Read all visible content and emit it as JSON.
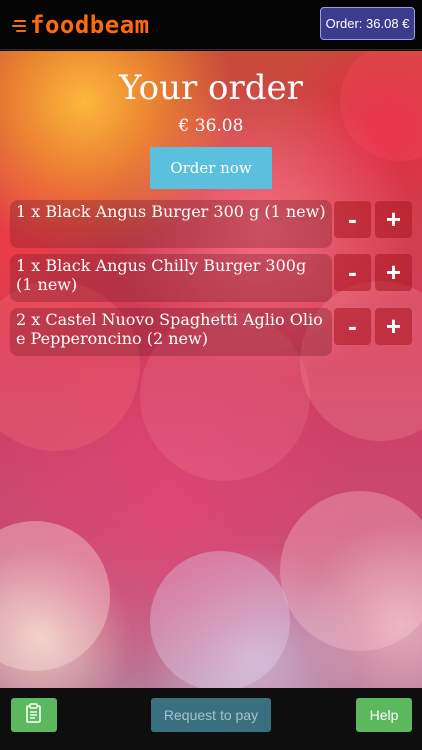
{
  "header": {
    "logo_text": "foodbeam",
    "order_button_label": "Order: 36.08 €"
  },
  "main": {
    "title": "Your order",
    "total": "€ 36.08",
    "order_now_label": "Order now",
    "items": [
      {
        "text": "1 x Black Angus Burger 300 g (1 new)",
        "minus": "-",
        "plus": "+"
      },
      {
        "text": "1 x Black Angus Chilly Burger 300g (1 new)",
        "minus": "-",
        "plus": "+"
      },
      {
        "text": "2 x Castel Nuovo Spaghetti Aglio Olio e Pepperoncino (2 new)",
        "minus": "-",
        "plus": "+"
      }
    ]
  },
  "footer": {
    "clipboard_icon": "clipboard-icon",
    "request_to_pay_label": "Request to pay",
    "help_label": "Help"
  },
  "colors": {
    "brand_orange": "#ff6a10",
    "order_button_bg": "#3b3c8e",
    "order_now_bg": "#5bc0de",
    "green_button": "#5cb85c",
    "disabled_button": "#3a6f80"
  }
}
